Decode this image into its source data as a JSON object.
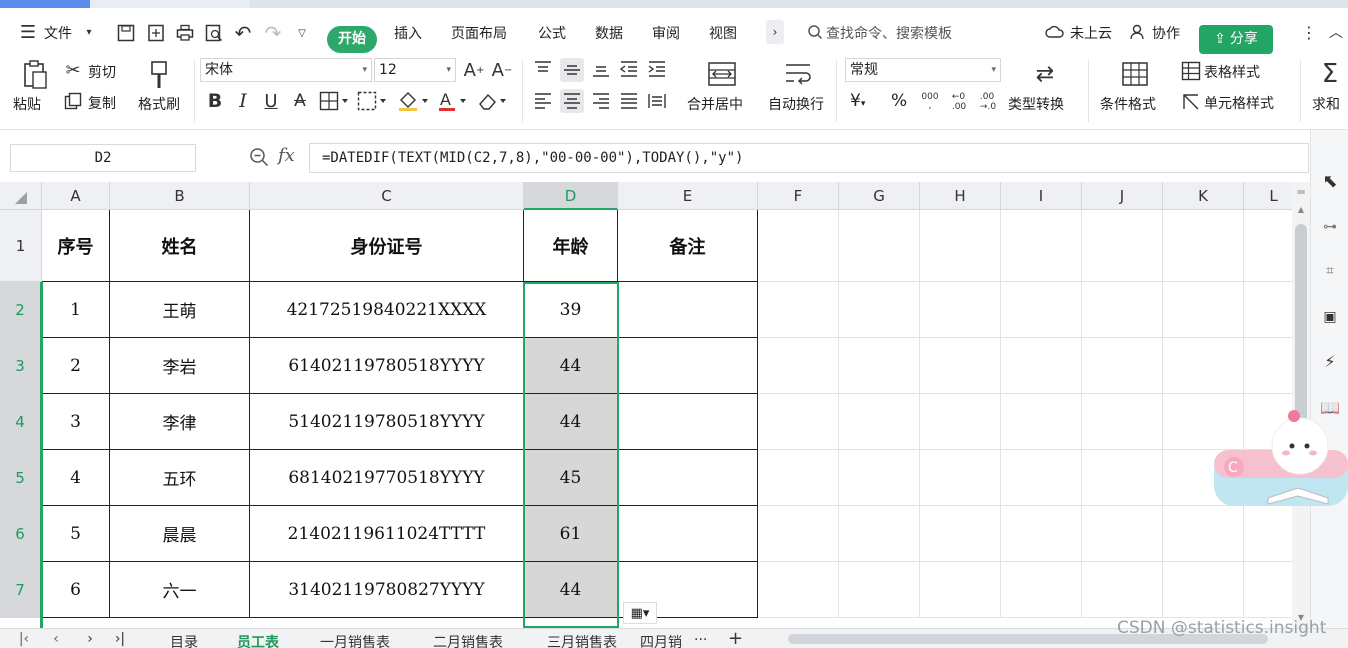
{
  "menubar": {
    "file_label": "文件",
    "tabs": [
      "开始",
      "插入",
      "页面布局",
      "公式",
      "数据",
      "审阅",
      "视图"
    ],
    "search_placeholder": "查找命令、搜索模板",
    "cloud_label": "未上云",
    "collab_label": "协作",
    "share_label": "分享"
  },
  "ribbon": {
    "paste": "粘贴",
    "cut": "剪切",
    "copy": "复制",
    "format_painter": "格式刷",
    "font_name": "宋体",
    "font_size": "12",
    "merge_center": "合并居中",
    "wrap": "自动换行",
    "number_format": "常规",
    "currency_symbol": "¥",
    "percent_symbol": "%",
    "type_convert": "类型转换",
    "cond_format": "条件格式",
    "table_style": "表格样式",
    "cell_style": "单元格样式",
    "sum": "求和"
  },
  "formula_bar": {
    "name_box": "D2",
    "fx": "fx",
    "formula": "=DATEDIF(TEXT(MID(C2,7,8),\"00-00-00\"),TODAY(),\"y\")"
  },
  "sheet": {
    "columns": [
      "A",
      "B",
      "C",
      "D",
      "E",
      "F",
      "G",
      "H",
      "I",
      "J",
      "K",
      "L"
    ],
    "rows": [
      "1",
      "2",
      "3",
      "4",
      "5",
      "6",
      "7"
    ],
    "header_row": [
      "序号",
      "姓名",
      "身份证号",
      "年龄",
      "备注"
    ],
    "data": [
      [
        "1",
        "王萌",
        "42172519840221XXXX",
        "39",
        ""
      ],
      [
        "2",
        "李岩",
        "61402119780518YYYY",
        "44",
        ""
      ],
      [
        "3",
        "李律",
        "51402119780518YYYY",
        "44",
        ""
      ],
      [
        "4",
        "五环",
        "68140219770518YYYY",
        "45",
        ""
      ],
      [
        "5",
        "晨晨",
        "21402119611024TTTT",
        "61",
        ""
      ],
      [
        "6",
        "六一",
        "31402119780827YYYY",
        "44",
        ""
      ]
    ],
    "selected_cell": "D2",
    "accent_color": "#22a565"
  },
  "sheet_tabs": {
    "tabs": [
      "目录",
      "员工表",
      "一月销售表",
      "二月销售表",
      "三月销售表",
      "四月销"
    ],
    "active": "员工表",
    "more": "···",
    "add": "+"
  },
  "watermark": "CSDN @statistics.insight"
}
